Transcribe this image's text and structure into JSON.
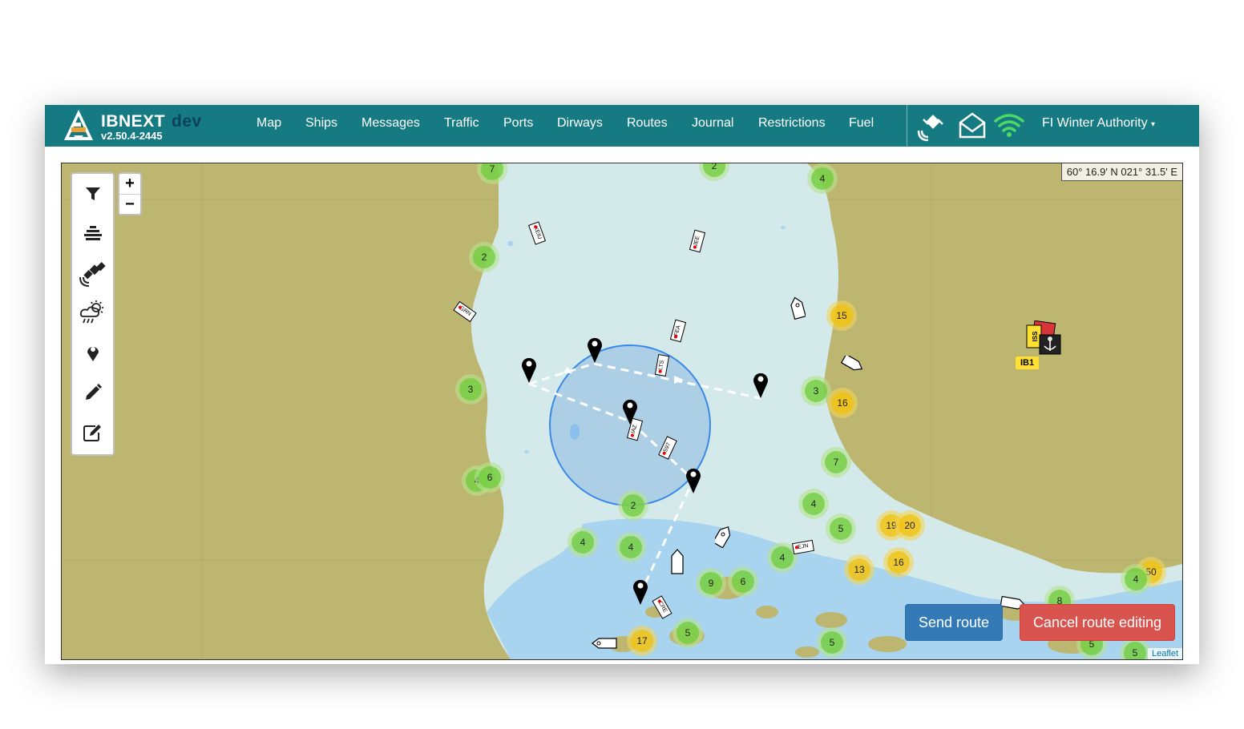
{
  "brand": {
    "name": "IBNEXT",
    "env": "dev",
    "version": "v2.50.4-2445"
  },
  "nav": {
    "items": [
      "Map",
      "Ships",
      "Messages",
      "Traffic",
      "Ports",
      "Dirways",
      "Routes",
      "Journal",
      "Restrictions",
      "Fuel"
    ]
  },
  "user": {
    "label": "FI Winter Authority"
  },
  "status_icons": [
    "satellite-icon",
    "envelope-icon",
    "wifi-icon"
  ],
  "toolbar": {
    "tools": [
      "filter-icon",
      "layers-icon",
      "satellite-icon",
      "weather-icon",
      "map-marker-icon",
      "pencil-icon",
      "edit-icon"
    ]
  },
  "zoom": {
    "in": "+",
    "out": "−"
  },
  "map": {
    "coordinates": "60° 16.9' N 021° 31.5' E",
    "attribution": "Leaflet",
    "clusters": [
      "7",
      "2",
      "4",
      "2",
      "15",
      "3",
      "16",
      "3",
      "7",
      "4",
      "6",
      "2",
      "4",
      "5",
      "19",
      "20",
      "4",
      "4",
      "4",
      "13",
      "16",
      "9",
      "6",
      "17",
      "5",
      "5",
      "50",
      "4",
      "8",
      "5",
      "5"
    ],
    "ships": [
      "KEIU",
      "JEE",
      "GRN",
      "FEA",
      "LTS",
      "IAZ",
      "S97",
      "EJN",
      "CRE"
    ],
    "icebreaker_label": "IB1",
    "icebreaker_tag": "ISS"
  },
  "actions": {
    "send_route": "Send route",
    "cancel_route": "Cancel route editing"
  },
  "colors": {
    "navbar": "#167a82",
    "land": "#bdb670",
    "water": "#d4eaea",
    "deep_water": "#a8d4f0",
    "send": "#337ab7",
    "cancel": "#d9534f",
    "cluster_green": "#6ecc39",
    "cluster_yellow": "#f0c20c"
  }
}
